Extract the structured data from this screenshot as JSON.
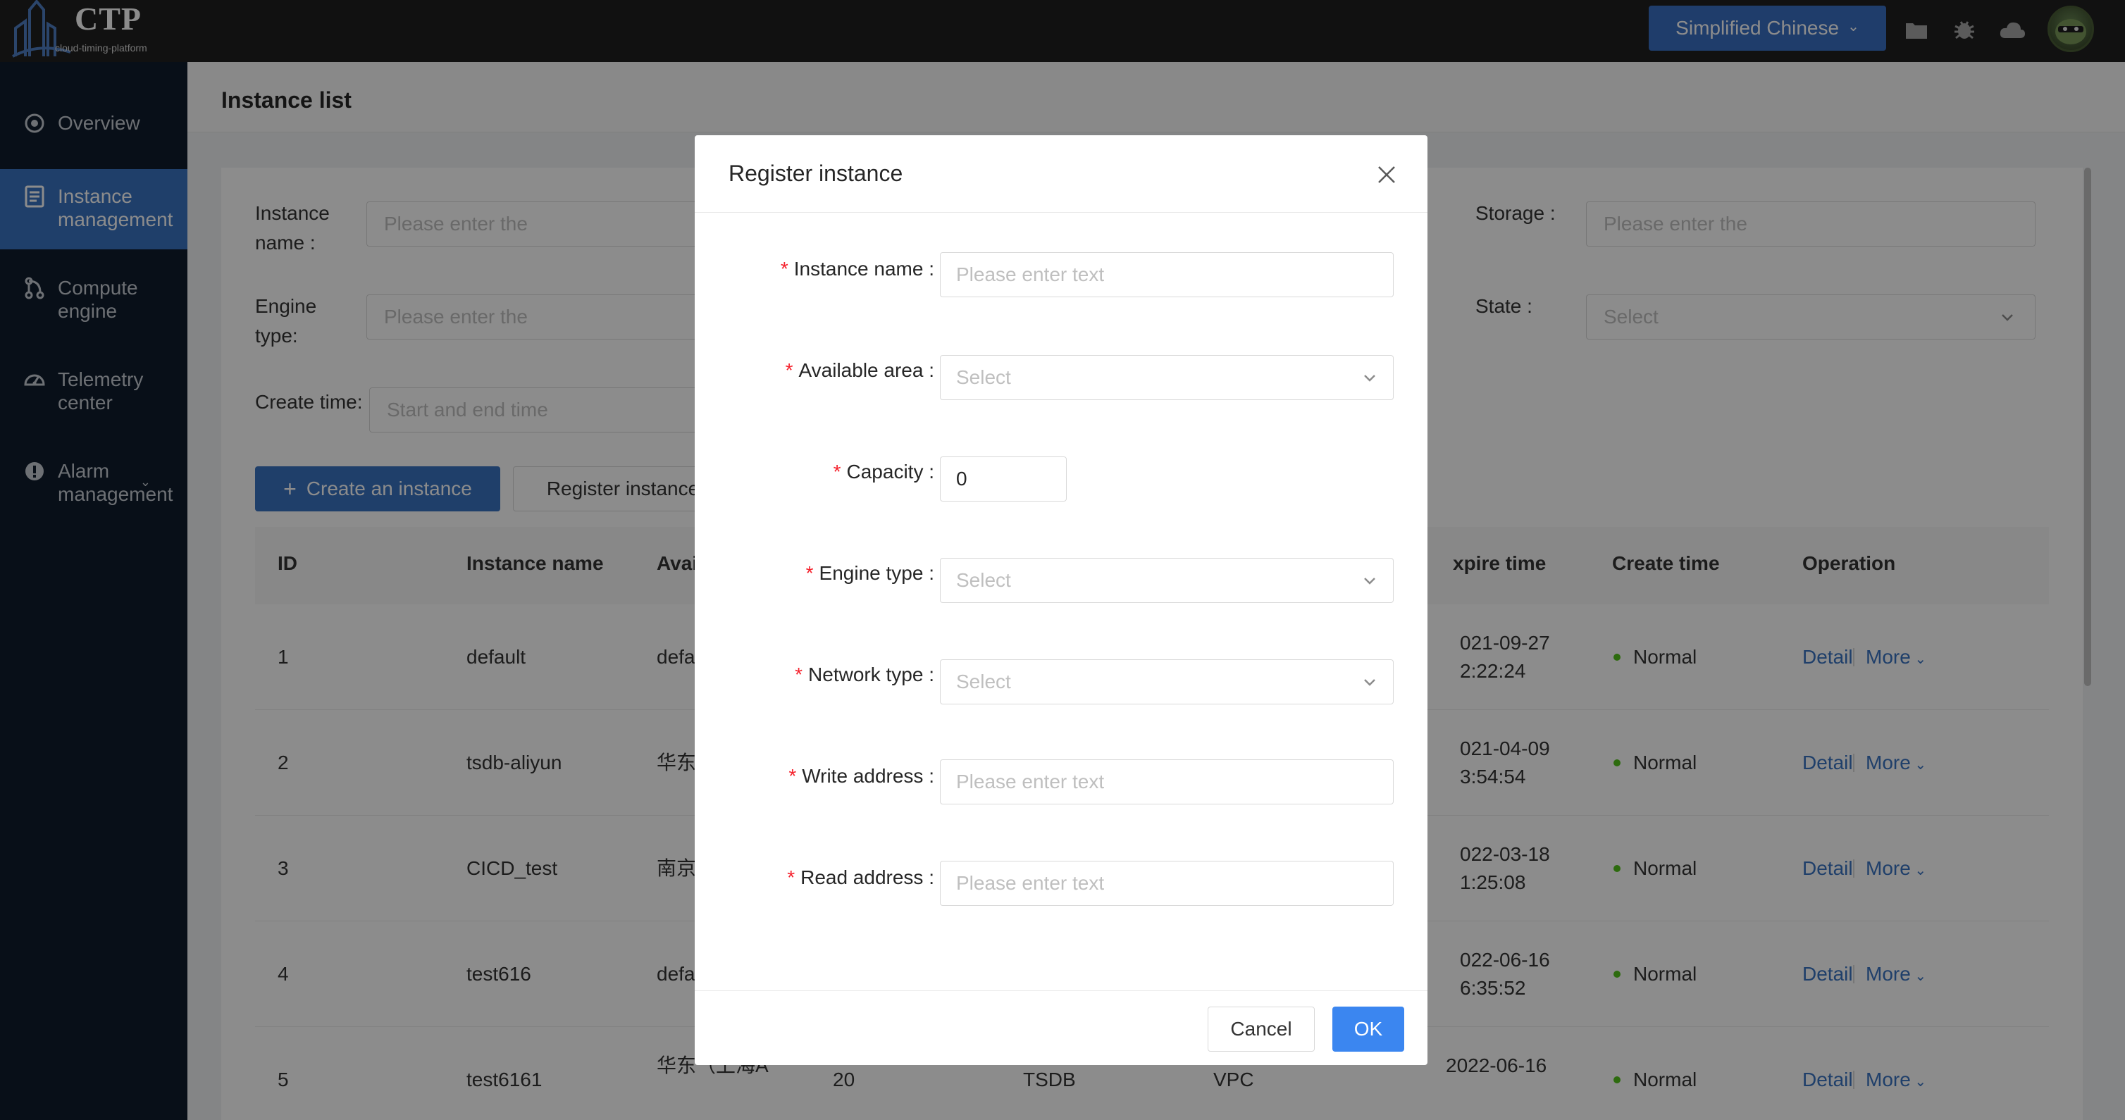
{
  "topbar": {
    "logo_text": "CTP",
    "logo_subtitle": "cloud-timing-platform",
    "language_button": "Simplified Chinese",
    "icons": [
      "folder-icon",
      "bug-icon",
      "cloud-icon"
    ]
  },
  "sidebar": {
    "items": [
      {
        "label": "Overview",
        "icon": "overview-icon"
      },
      {
        "label": "Instance management",
        "icon": "document-icon"
      },
      {
        "label": "Compute engine",
        "icon": "compute-icon"
      },
      {
        "label": "Telemetry center",
        "icon": "telemetry-icon"
      },
      {
        "label": "Alarm management",
        "icon": "alarm-icon"
      }
    ]
  },
  "page": {
    "title": "Instance list"
  },
  "filters": {
    "instance_name": {
      "label": "Instance name :",
      "placeholder": "Please enter the"
    },
    "engine_type": {
      "label": "Engine type:",
      "placeholder": "Please enter the"
    },
    "create_time": {
      "label": "Create time:",
      "placeholder": "Start and end time"
    },
    "storage": {
      "label": "Storage :",
      "placeholder": "Please enter the"
    },
    "state": {
      "label": "State :",
      "placeholder": "Select"
    }
  },
  "actions": {
    "create_label": "Create an instance",
    "register_label": "Register instance"
  },
  "table": {
    "columns": [
      "ID",
      "Instance name",
      "Avai",
      "xpire time",
      "Create time",
      "Operation"
    ],
    "rows": [
      {
        "id": "1",
        "name": "default",
        "area": "defa",
        "expire_line1": "021-09-27",
        "expire_line2": "2:22:24",
        "status": "Normal",
        "detail": "Detail",
        "more": "More"
      },
      {
        "id": "2",
        "name": "tsdb-aliyun",
        "area": "华东",
        "expire_line1": "021-04-09",
        "expire_line2": "3:54:54",
        "status": "Normal",
        "detail": "Detail",
        "more": "More"
      },
      {
        "id": "3",
        "name": "CICD_test",
        "area": "南京",
        "expire_line1": "022-03-18",
        "expire_line2": "1:25:08",
        "status": "Normal",
        "detail": "Detail",
        "more": "More"
      },
      {
        "id": "4",
        "name": "test616",
        "area": "defa",
        "expire_line1": "022-06-16",
        "expire_line2": "6:35:52",
        "status": "Normal",
        "detail": "Detail",
        "more": "More"
      },
      {
        "id": "5",
        "name": "test6161",
        "area": "华东（上海A",
        "capacity": "20",
        "engine": "TSDB",
        "network": "VPC",
        "expire_line1": "2022-06-16",
        "expire_line2": "",
        "status": "Normal",
        "detail": "Detail",
        "more": "More"
      }
    ]
  },
  "modal": {
    "title": "Register instance",
    "required_mark": "*",
    "fields": [
      {
        "label": "Instance name",
        "placeholder": "Please enter text",
        "type": "text"
      },
      {
        "label": "Available area",
        "placeholder": "Select",
        "type": "select"
      },
      {
        "label": "Capacity",
        "value": "0",
        "type": "number"
      },
      {
        "label": "Engine type",
        "placeholder": "Select",
        "type": "select"
      },
      {
        "label": "Network type",
        "placeholder": "Select",
        "type": "select"
      },
      {
        "label": "Write address",
        "placeholder": "Please enter text",
        "type": "text"
      },
      {
        "label": "Read address",
        "placeholder": "Please enter text",
        "type": "text"
      }
    ],
    "cancel_label": "Cancel",
    "ok_label": "OK"
  },
  "colors": {
    "primary": "#3a73c2",
    "sidebar_bg": "#0f1c2c",
    "topbar_bg": "#1f1f1f",
    "status_normal": "#52c41a",
    "required": "#f5222d"
  }
}
